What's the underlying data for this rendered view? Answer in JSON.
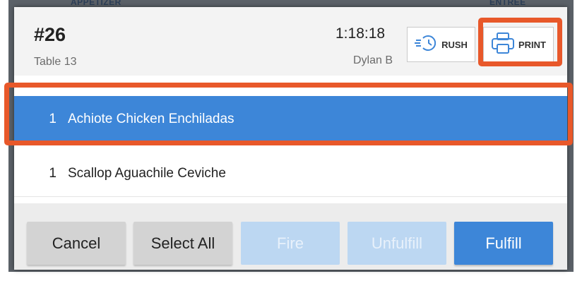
{
  "background": {
    "label_left": "APPETIZER",
    "label_right": "ENTREE"
  },
  "ticket": {
    "order_number": "#26",
    "table": "Table 13",
    "elapsed_time": "1:18:18",
    "server": "Dylan B",
    "rush_label": "RUSH",
    "print_label": "PRINT"
  },
  "items": [
    {
      "qty": "1",
      "name": "Achiote Chicken Enchiladas",
      "selected": true
    },
    {
      "qty": "1",
      "name": "Scallop Aguachile Ceviche",
      "selected": false
    }
  ],
  "footer": {
    "cancel": "Cancel",
    "select_all": "Select All",
    "fire": "Fire",
    "unfulfill": "Unfulfill",
    "fulfill": "Fulfill"
  },
  "colors": {
    "accent": "#3d86d8",
    "highlight": "#e8582a",
    "disabled": "#bcd7f2"
  }
}
